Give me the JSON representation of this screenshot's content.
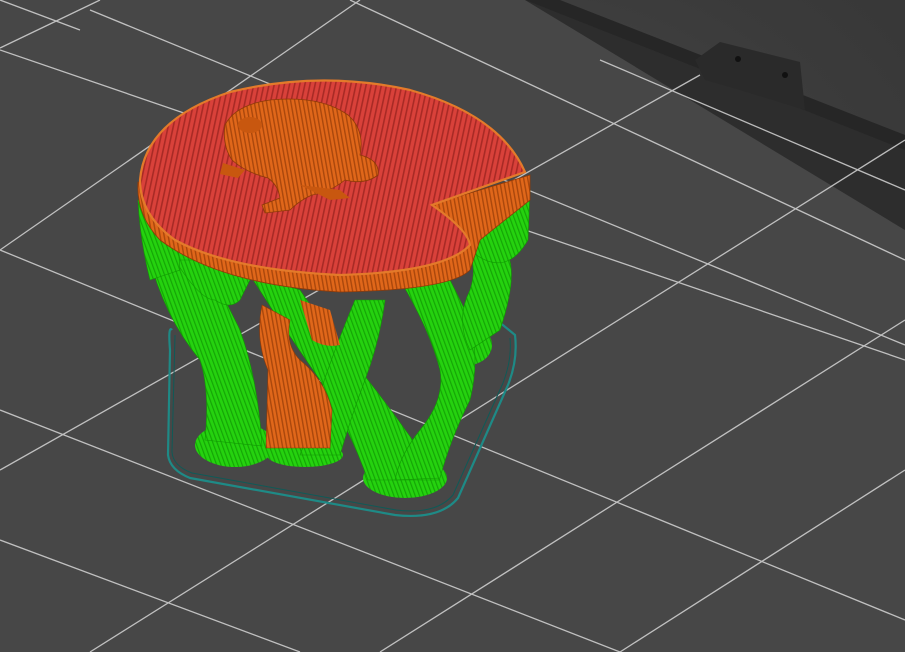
{
  "viewport": {
    "label": "",
    "background": "#3a3a3a"
  },
  "colors": {
    "bed": "#444444",
    "bed_edge": "#2b2b2b",
    "grid_line": "#d9d9d9",
    "support_material": "#25d20f",
    "perimeter": "#e0671a",
    "top_solid_infill": "#d9413a",
    "skirt": "#1e8a86"
  },
  "icons": {
    "bed_mount": "bed-mount-bracket-icon"
  }
}
